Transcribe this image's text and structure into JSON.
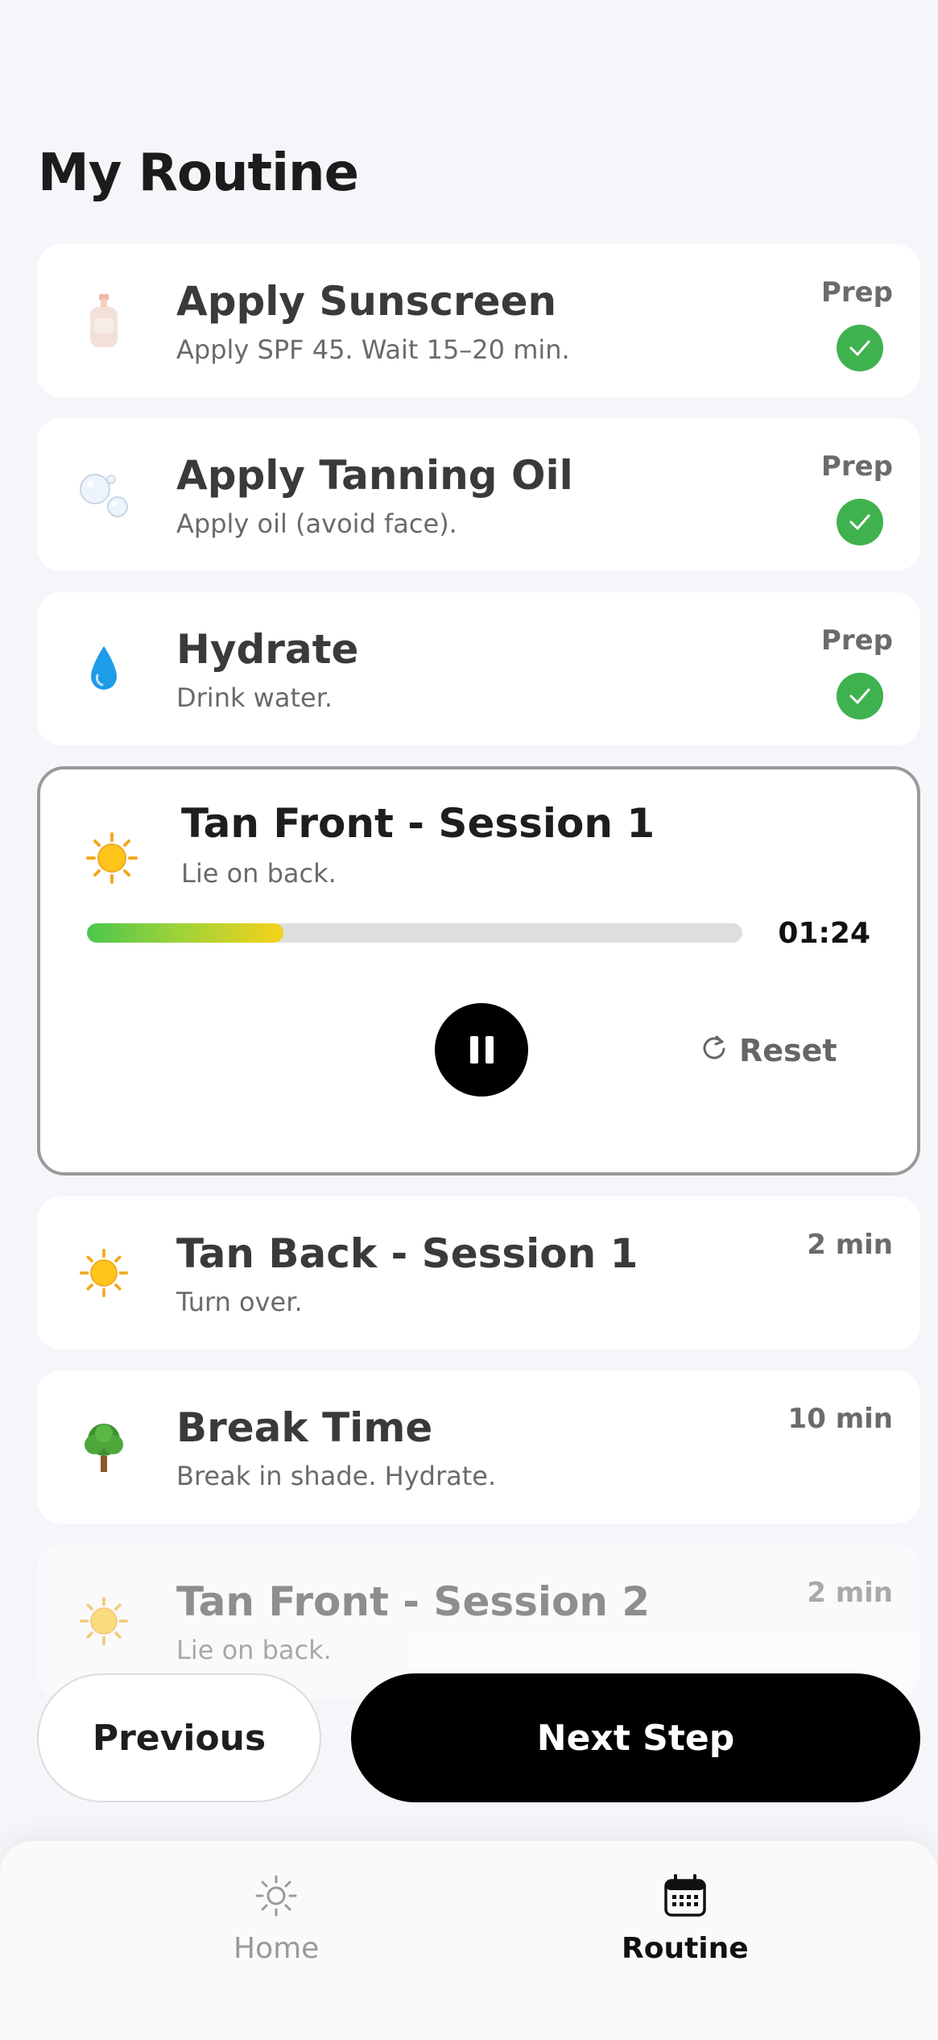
{
  "header": {
    "title": "My Routine"
  },
  "steps": [
    {
      "icon": "lotion-bottle-icon",
      "title": "Apply Sunscreen",
      "desc": "Apply SPF 45. Wait 15–20 min.",
      "tag": "Prep",
      "done": true
    },
    {
      "icon": "bubbles-icon",
      "title": "Apply Tanning Oil",
      "desc": "Apply oil (avoid face).",
      "tag": "Prep",
      "done": true
    },
    {
      "icon": "droplet-icon",
      "title": "Hydrate",
      "desc": "Drink water.",
      "tag": "Prep",
      "done": true
    }
  ],
  "active": {
    "icon": "sun-icon",
    "title": "Tan Front - Session 1",
    "desc": "Lie on back.",
    "progress": 0.3,
    "timer": "01:24",
    "reset_label": "Reset"
  },
  "upcoming": [
    {
      "icon": "sun-icon",
      "title": "Tan Back - Session 1",
      "desc": "Turn over.",
      "tag": "2 min"
    },
    {
      "icon": "tree-icon",
      "title": "Break Time",
      "desc": "Break in shade. Hydrate.",
      "tag": "10 min"
    },
    {
      "icon": "sun-icon",
      "title": "Tan Front - Session 2",
      "desc": "Lie on back.",
      "tag": "2 min"
    }
  ],
  "actions": {
    "previous": "Previous",
    "next": "Next Step"
  },
  "tabs": {
    "home": "Home",
    "routine": "Routine"
  },
  "colors": {
    "accent": "#000000",
    "check": "#3fb24f",
    "progress_start": "#4cc64f",
    "progress_end": "#f6d21a"
  }
}
